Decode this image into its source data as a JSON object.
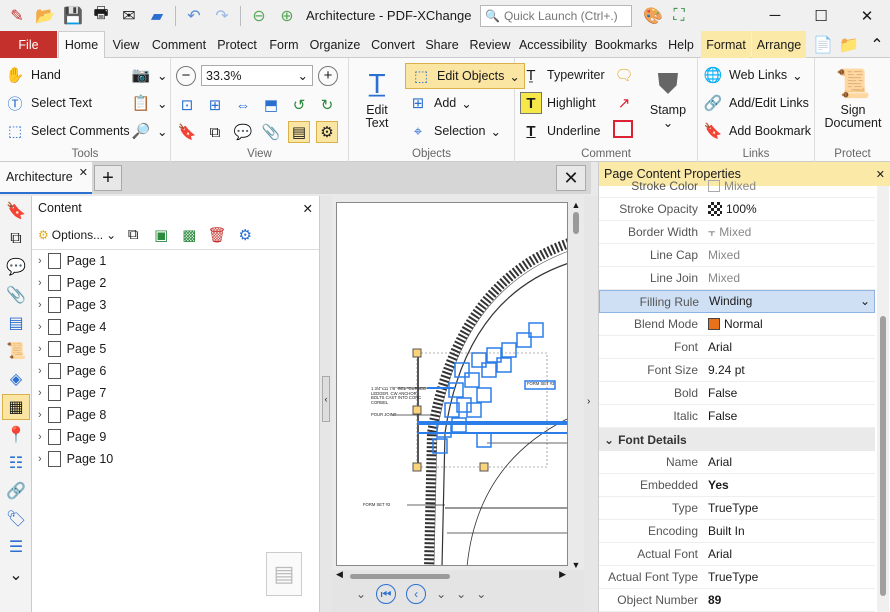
{
  "window": {
    "title": "Architecture - PDF-XChange E...",
    "search_placeholder": "Quick Launch (Ctrl+.)"
  },
  "tabs": [
    "File",
    "Home",
    "View",
    "Comment",
    "Protect",
    "Form",
    "Organize",
    "Convert",
    "Share",
    "Review",
    "Accessibility",
    "Bookmarks",
    "Help",
    "Format",
    "Arrange"
  ],
  "ribbon": {
    "tools": {
      "label": "Tools",
      "hand": "Hand",
      "select_text": "Select Text",
      "select_comments": "Select Comments"
    },
    "view": {
      "label": "View",
      "zoom": "33.3%"
    },
    "objects": {
      "label": "Objects",
      "edit_text": "Edit Text",
      "edit_objects": "Edit Objects",
      "add": "Add",
      "selection": "Selection"
    },
    "comment": {
      "label": "Comment",
      "typewriter": "Typewriter",
      "highlight": "Highlight",
      "underline": "Underline",
      "stamp": "Stamp"
    },
    "links": {
      "label": "Links",
      "web_links": "Web Links",
      "add_edit_links": "Add/Edit Links",
      "add_bookmark": "Add Bookmark"
    },
    "protect": {
      "label": "Protect",
      "sign_document": "Sign Document"
    }
  },
  "document": {
    "tab": "Architecture"
  },
  "content_pane": {
    "title": "Content",
    "options": "Options...",
    "pages": [
      "Page 1",
      "Page 2",
      "Page 3",
      "Page 4",
      "Page 5",
      "Page 6",
      "Page 7",
      "Page 8",
      "Page 9",
      "Page 10"
    ]
  },
  "drawing": {
    "note1": "1 3/4\"x11 7/8\" SCL \"CURVED LEDGER. CW ANCHOR BOLTS CAST INTO CONC CORBEL",
    "note2": "POUR JOINT",
    "note3": "FORM SET #3",
    "note4": "FORM SET #2"
  },
  "properties": {
    "title": "Page Content Properties",
    "rows": [
      {
        "k": "Stroke Color",
        "v": "Mixed"
      },
      {
        "k": "Stroke Opacity",
        "v": "100%"
      },
      {
        "k": "Border Width",
        "v": "Mixed"
      },
      {
        "k": "Line Cap",
        "v": "Mixed"
      },
      {
        "k": "Line Join",
        "v": "Mixed"
      },
      {
        "k": "Filling Rule",
        "v": "Winding"
      },
      {
        "k": "Blend Mode",
        "v": "Normal"
      },
      {
        "k": "Font",
        "v": "Arial"
      },
      {
        "k": "Font Size",
        "v": "9.24 pt"
      },
      {
        "k": "Bold",
        "v": "False"
      },
      {
        "k": "Italic",
        "v": "False"
      }
    ],
    "section": "Font Details",
    "rows2": [
      {
        "k": "Name",
        "v": "Arial"
      },
      {
        "k": "Embedded",
        "v": "Yes"
      },
      {
        "k": "Type",
        "v": "TrueType"
      },
      {
        "k": "Encoding",
        "v": "Built In"
      },
      {
        "k": "Actual Font",
        "v": "Arial"
      },
      {
        "k": "Actual Font Type",
        "v": "TrueType"
      },
      {
        "k": "Object Number",
        "v": "89"
      }
    ]
  },
  "colors": {
    "accent": "#c4302b",
    "context_tab": "#fbe9a8",
    "selection": "#2b7de9"
  }
}
